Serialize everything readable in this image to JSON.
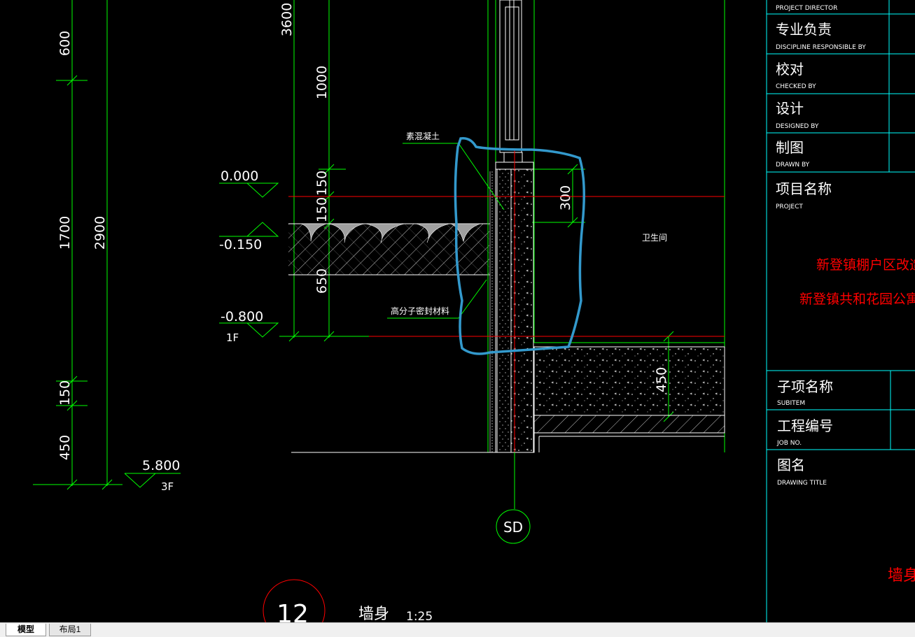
{
  "drawing": {
    "levels": [
      {
        "elev": "0.000"
      },
      {
        "elev": "-0.150"
      },
      {
        "elev": "-0.800",
        "floor": "1F"
      },
      {
        "elev": "5.800",
        "floor": "3F"
      }
    ],
    "dims_left": [
      "600",
      "1700",
      "2900",
      "150",
      "450"
    ],
    "dims_mid": [
      "3600",
      "1000",
      "150",
      "150",
      "650"
    ],
    "dims_right": [
      "300",
      "450"
    ],
    "labels": {
      "concrete": "素混凝土",
      "sealant": "高分子密封材料",
      "room": "卫生间"
    },
    "axis_bubble": "SD",
    "detail": {
      "number": "12",
      "title": "墙身",
      "scale": "1:25"
    }
  },
  "title_block": {
    "rows": [
      {
        "cn": "",
        "en": "PROJECT DIRECTOR"
      },
      {
        "cn": "专业负责",
        "en": "DISCIPLINE RESPONSIBLE BY"
      },
      {
        "cn": "校对",
        "en": "CHECKED BY"
      },
      {
        "cn": "设计",
        "en": "DESIGNED BY"
      },
      {
        "cn": "制图",
        "en": "DRAWN BY"
      },
      {
        "cn": "项目名称",
        "en": "PROJECT"
      }
    ],
    "project_names": [
      "新登镇棚户区改造",
      "新登镇共和花园公寓"
    ],
    "subitem": {
      "cn": "子项名称",
      "en": "SUBITEM"
    },
    "job_no": {
      "cn": "工程编号",
      "en": "JOB NO."
    },
    "drawing_title": {
      "cn": "图名",
      "en": "DRAWING TITLE"
    },
    "title_value": "墙身"
  },
  "tabs": {
    "model": "模型",
    "layout1": "布局1"
  },
  "colors": {
    "dim": "#00ff00",
    "frame": "#00ffff",
    "red": "#ff0000",
    "white": "#ffffff",
    "highlight": "#3399cc",
    "gray": "#a0a0a0"
  }
}
